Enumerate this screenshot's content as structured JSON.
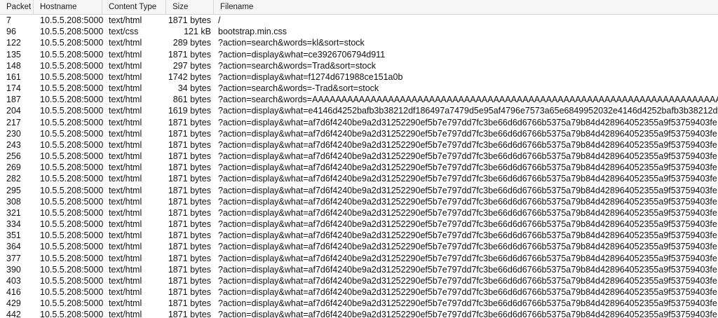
{
  "columns": {
    "packet": "Packet",
    "hostname": "Hostname",
    "content_type": "Content Type",
    "size": "Size",
    "filename": "Filename"
  },
  "rows": [
    {
      "packet": "7",
      "hostname": "10.5.5.208:5000",
      "content_type": "text/html",
      "size": "1871 bytes",
      "filename": "/"
    },
    {
      "packet": "96",
      "hostname": "10.5.5.208:5000",
      "content_type": "text/css",
      "size": "121 kB",
      "filename": "bootstrap.min.css"
    },
    {
      "packet": "122",
      "hostname": "10.5.5.208:5000",
      "content_type": "text/html",
      "size": "289 bytes",
      "filename": "?action=search&words=kl&sort=stock"
    },
    {
      "packet": "135",
      "hostname": "10.5.5.208:5000",
      "content_type": "text/html",
      "size": "1871 bytes",
      "filename": "?action=display&what=ce3926706794d911"
    },
    {
      "packet": "148",
      "hostname": "10.5.5.208:5000",
      "content_type": "text/html",
      "size": "297 bytes",
      "filename": "?action=search&words=Trad&sort=stock"
    },
    {
      "packet": "161",
      "hostname": "10.5.5.208:5000",
      "content_type": "text/html",
      "size": "1742 bytes",
      "filename": "?action=display&what=f1274d671988ce151a0b"
    },
    {
      "packet": "174",
      "hostname": "10.5.5.208:5000",
      "content_type": "text/html",
      "size": "34 bytes",
      "filename": "?action=search&words=-Trad&sort=stock"
    },
    {
      "packet": "187",
      "hostname": "10.5.5.208:5000",
      "content_type": "text/html",
      "size": "861 bytes",
      "filename": "?action=search&words=AAAAAAAAAAAAAAAAAAAAAAAAAAAAAAAAAAAAAAAAAAAAAAAAAAAAAAAAAAAAAAAAAAAAAAAAAAAAAAAAAAAAAAA"
    },
    {
      "packet": "204",
      "hostname": "10.5.5.208:5000",
      "content_type": "text/html",
      "size": "1619 bytes",
      "filename": "?action=display&what=e4146d4252bafb3b38212df186497a7479d5e95af4796e7573a65e6849952032e4146d4252bafb3b38212df"
    },
    {
      "packet": "217",
      "hostname": "10.5.5.208:5000",
      "content_type": "text/html",
      "size": "1871 bytes",
      "filename": "?action=display&what=af7d6f4240be9a2d31252290ef5b7e797dd7fc3be66d6d6766b5375a79b84d428964052355a9f53759403fe"
    },
    {
      "packet": "230",
      "hostname": "10.5.5.208:5000",
      "content_type": "text/html",
      "size": "1871 bytes",
      "filename": "?action=display&what=af7d6f4240be9a2d31252290ef5b7e797dd7fc3be66d6d6766b5375a79b84d428964052355a9f53759403fe"
    },
    {
      "packet": "243",
      "hostname": "10.5.5.208:5000",
      "content_type": "text/html",
      "size": "1871 bytes",
      "filename": "?action=display&what=af7d6f4240be9a2d31252290ef5b7e797dd7fc3be66d6d6766b5375a79b84d428964052355a9f53759403fe"
    },
    {
      "packet": "256",
      "hostname": "10.5.5.208:5000",
      "content_type": "text/html",
      "size": "1871 bytes",
      "filename": "?action=display&what=af7d6f4240be9a2d31252290ef5b7e797dd7fc3be66d6d6766b5375a79b84d428964052355a9f53759403fe"
    },
    {
      "packet": "269",
      "hostname": "10.5.5.208:5000",
      "content_type": "text/html",
      "size": "1871 bytes",
      "filename": "?action=display&what=af7d6f4240be9a2d31252290ef5b7e797dd7fc3be66d6d6766b5375a79b84d428964052355a9f53759403fe"
    },
    {
      "packet": "282",
      "hostname": "10.5.5.208:5000",
      "content_type": "text/html",
      "size": "1871 bytes",
      "filename": "?action=display&what=af7d6f4240be9a2d31252290ef5b7e797dd7fc3be66d6d6766b5375a79b84d428964052355a9f53759403fe"
    },
    {
      "packet": "295",
      "hostname": "10.5.5.208:5000",
      "content_type": "text/html",
      "size": "1871 bytes",
      "filename": "?action=display&what=af7d6f4240be9a2d31252290ef5b7e797dd7fc3be66d6d6766b5375a79b84d428964052355a9f53759403fe"
    },
    {
      "packet": "308",
      "hostname": "10.5.5.208:5000",
      "content_type": "text/html",
      "size": "1871 bytes",
      "filename": "?action=display&what=af7d6f4240be9a2d31252290ef5b7e797dd7fc3be66d6d6766b5375a79b84d428964052355a9f53759403fe"
    },
    {
      "packet": "321",
      "hostname": "10.5.5.208:5000",
      "content_type": "text/html",
      "size": "1871 bytes",
      "filename": "?action=display&what=af7d6f4240be9a2d31252290ef5b7e797dd7fc3be66d6d6766b5375a79b84d428964052355a9f53759403fe"
    },
    {
      "packet": "334",
      "hostname": "10.5.5.208:5000",
      "content_type": "text/html",
      "size": "1871 bytes",
      "filename": "?action=display&what=af7d6f4240be9a2d31252290ef5b7e797dd7fc3be66d6d6766b5375a79b84d428964052355a9f53759403fe"
    },
    {
      "packet": "351",
      "hostname": "10.5.5.208:5000",
      "content_type": "text/html",
      "size": "1871 bytes",
      "filename": "?action=display&what=af7d6f4240be9a2d31252290ef5b7e797dd7fc3be66d6d6766b5375a79b84d428964052355a9f53759403fe"
    },
    {
      "packet": "364",
      "hostname": "10.5.5.208:5000",
      "content_type": "text/html",
      "size": "1871 bytes",
      "filename": "?action=display&what=af7d6f4240be9a2d31252290ef5b7e797dd7fc3be66d6d6766b5375a79b84d428964052355a9f53759403fe"
    },
    {
      "packet": "377",
      "hostname": "10.5.5.208:5000",
      "content_type": "text/html",
      "size": "1871 bytes",
      "filename": "?action=display&what=af7d6f4240be9a2d31252290ef5b7e797dd7fc3be66d6d6766b5375a79b84d428964052355a9f53759403fe"
    },
    {
      "packet": "390",
      "hostname": "10.5.5.208:5000",
      "content_type": "text/html",
      "size": "1871 bytes",
      "filename": "?action=display&what=af7d6f4240be9a2d31252290ef5b7e797dd7fc3be66d6d6766b5375a79b84d428964052355a9f53759403fe"
    },
    {
      "packet": "403",
      "hostname": "10.5.5.208:5000",
      "content_type": "text/html",
      "size": "1871 bytes",
      "filename": "?action=display&what=af7d6f4240be9a2d31252290ef5b7e797dd7fc3be66d6d6766b5375a79b84d428964052355a9f53759403fe"
    },
    {
      "packet": "416",
      "hostname": "10.5.5.208:5000",
      "content_type": "text/html",
      "size": "1871 bytes",
      "filename": "?action=display&what=af7d6f4240be9a2d31252290ef5b7e797dd7fc3be66d6d6766b5375a79b84d428964052355a9f53759403fe"
    },
    {
      "packet": "429",
      "hostname": "10.5.5.208:5000",
      "content_type": "text/html",
      "size": "1871 bytes",
      "filename": "?action=display&what=af7d6f4240be9a2d31252290ef5b7e797dd7fc3be66d6d6766b5375a79b84d428964052355a9f53759403fe"
    },
    {
      "packet": "442",
      "hostname": "10.5.5.208:5000",
      "content_type": "text/html",
      "size": "1871 bytes",
      "filename": "?action=display&what=af7d6f4240be9a2d31252290ef5b7e797dd7fc3be66d6d6766b5375a79b84d428964052355a9f53759403fe"
    }
  ]
}
